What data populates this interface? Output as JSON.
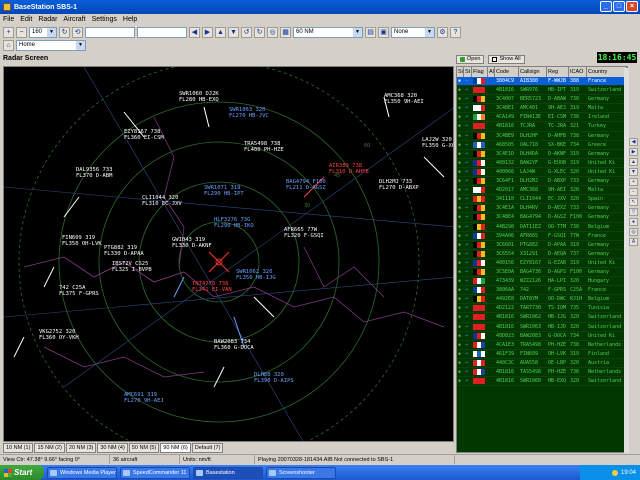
{
  "window": {
    "title": "BaseStation SBS-1"
  },
  "menu": [
    "File",
    "Edit",
    "Radar",
    "Aircraft",
    "Settings",
    "Help"
  ],
  "toolbar": {
    "zoom_value": "160",
    "range_value": "60 NM",
    "filter_value": "None"
  },
  "toolbar2": {
    "location_value": "Home"
  },
  "clock": "18:16:45",
  "radar": {
    "title": "Radar Screen",
    "aircraft": [
      {
        "label": "SWR1060 DJ2K\nFL280 HB-EXQ",
        "color": "white"
      },
      {
        "label": "SWR1063 320\nFL270 HB-JVC",
        "color": "blue"
      },
      {
        "label": "AMC368 320\nFL350 9H-AEI",
        "color": "white"
      },
      {
        "label": "EZY8167 738\nFL360 EI-CSM",
        "color": "white"
      },
      {
        "label": "LAJ2W 320\nFL350 G-XC",
        "color": "white"
      },
      {
        "label": "TRA5498 738\nFL400 PH-HZE",
        "color": "white"
      },
      {
        "label": "SWR1071 319\nFL290 HB-IPT",
        "color": "blue"
      },
      {
        "label": "AIR389 738\nFL310 D-AHFB",
        "color": "red"
      },
      {
        "label": "DLH2MJ 733\nFL270 D-ABXP",
        "color": "white"
      },
      {
        "label": "DAL9356 733\nFL370 D-ABM",
        "color": "white"
      },
      {
        "label": "BAG4794 F100\nFL211 D-AGSZ",
        "color": "blue"
      },
      {
        "label": "HLF3276 73G\nFL290 HB-IKO",
        "color": "blue"
      },
      {
        "label": "CLI1044 320\nFL310 EC-JXV",
        "color": "white"
      },
      {
        "label": "FIN609 319\nFL350 OH-LVK",
        "color": "white"
      },
      {
        "label": "PTG882 319\nFL330 D-APAA",
        "color": "white"
      },
      {
        "label": "GWI043 319\nFL330 D-AKNF",
        "color": "white"
      },
      {
        "label": "AFR665 77W\nFL320 F-GSQI",
        "color": "white"
      },
      {
        "label": "IBS72V CS25\nFL325 I-BVPB",
        "color": "white"
      },
      {
        "label": "742 C25A\nFL375 F-GPRS",
        "color": "white"
      },
      {
        "label": "VKG2752 320\nFL360 OY-VKH",
        "color": "white"
      },
      {
        "label": "TNT4778 738\nFL341 EI-VAN",
        "color": "red"
      },
      {
        "label": "SWR1062 320\nFL350 HB-IJG",
        "color": "blue"
      },
      {
        "label": "BAW2083 734\nFL360 G-DOCA",
        "color": "white"
      },
      {
        "label": "AMC691 319\nFL270 9H-AEJ",
        "color": "blue"
      },
      {
        "label": "DLH88 320\nFL390 D-AIPS",
        "color": "blue"
      }
    ]
  },
  "tabs": [
    "10 NM (1)",
    "15 NM (2)",
    "20 NM (3)",
    "30 NM (4)",
    "50 NM (5)",
    "90 NM (6)",
    "Default (7)"
  ],
  "status": {
    "view": "View Ctr: 47.38° 9.66° facing 0°",
    "count": "36 aircraft",
    "units": "Units: nm/ft",
    "playing": "Playing 20070328-181434.AIB Not connected to SBS-1"
  },
  "list": {
    "open_label": "Open",
    "show_all_label": "Show All",
    "columns": [
      "Si",
      "St",
      "Flag",
      "Alt",
      "Code",
      "Callsign",
      "Reg",
      "ICAO",
      "Country"
    ],
    "rows": [
      {
        "code": "3804C9",
        "callsign": "AIB380",
        "reg": "F-WWJB",
        "icao": "388",
        "country": "France",
        "flag": [
          "#0040a0",
          "#ffffff",
          "#e02020"
        ],
        "sel": true
      },
      {
        "code": "4B1816",
        "callsign": "SWR976",
        "reg": "HB-IPT",
        "icao": "319",
        "country": "Switzerland",
        "flag": [
          "#e02020",
          "#e02020",
          "#e02020"
        ]
      },
      {
        "code": "3C4007",
        "callsign": "BER5723",
        "reg": "D-ABAW",
        "icao": "738",
        "country": "Germany",
        "flag": [
          "#000000",
          "#e02020",
          "#f0c020"
        ]
      },
      {
        "code": "3C4BE1",
        "callsign": "AMC401",
        "reg": "9H-AEJ",
        "icao": "319",
        "country": "Malta",
        "flag": [
          "#ffffff",
          "#ffffff",
          "#e02020"
        ]
      },
      {
        "code": "4CA149",
        "callsign": "FIN413E",
        "reg": "EI-CSM",
        "icao": "738",
        "country": "Ireland",
        "flag": [
          "#20a040",
          "#ffffff",
          "#f08020"
        ]
      },
      {
        "code": "4B1816",
        "callsign": "TCJRA",
        "reg": "TC-JRA",
        "icao": "321",
        "country": "Turkey",
        "flag": [
          "#e02020",
          "#e02020",
          "#e02020"
        ]
      },
      {
        "code": "3C4BE9",
        "callsign": "DLH2HF",
        "reg": "D-AHFB",
        "icao": "738",
        "country": "Germany",
        "flag": [
          "#000000",
          "#e02020",
          "#f0c020"
        ]
      },
      {
        "code": "468505",
        "callsign": "OAL718",
        "reg": "SX-BKE",
        "icao": "734",
        "country": "Greece",
        "flag": [
          "#2060c0",
          "#ffffff",
          "#2060c0"
        ]
      },
      {
        "code": "3C4E1D",
        "callsign": "DLH4DA",
        "reg": "D-AKNF",
        "icao": "319",
        "country": "Germany",
        "flag": [
          "#000000",
          "#e02020",
          "#f0c020"
        ]
      },
      {
        "code": "400132",
        "callsign": "BAW2YF",
        "reg": "G-EUOB",
        "icao": "319",
        "country": "United Ki",
        "flag": [
          "#1030a0",
          "#e02020",
          "#ffffff"
        ]
      },
      {
        "code": "400066",
        "callsign": "LAJ4W",
        "reg": "G-XLEC",
        "icao": "320",
        "country": "United Ki",
        "flag": [
          "#1030a0",
          "#e02020",
          "#ffffff"
        ]
      },
      {
        "code": "3C64F1",
        "callsign": "DLH2MJ",
        "reg": "D-ABXP",
        "icao": "733",
        "country": "Germany",
        "flag": [
          "#000000",
          "#e02020",
          "#f0c020"
        ]
      },
      {
        "code": "4D2017",
        "callsign": "AMC368",
        "reg": "9H-AEI",
        "icao": "320",
        "country": "Malta",
        "flag": [
          "#ffffff",
          "#ffffff",
          "#e02020"
        ]
      },
      {
        "code": "341110",
        "callsign": "CLI1044",
        "reg": "EC-JXV",
        "icao": "320",
        "country": "Spain",
        "flag": [
          "#e02020",
          "#f0c020",
          "#e02020"
        ]
      },
      {
        "code": "3C4E1A",
        "callsign": "DLH4RV",
        "reg": "D-AEXZ",
        "icao": "733",
        "country": "Germany",
        "flag": [
          "#000000",
          "#e02020",
          "#f0c020"
        ]
      },
      {
        "code": "3C4BE4",
        "callsign": "BAG4794",
        "reg": "D-AGSZ",
        "icao": "F100",
        "country": "Germany",
        "flag": [
          "#000000",
          "#e02020",
          "#f0c020"
        ]
      },
      {
        "code": "44B298",
        "callsign": "DAT11EZ",
        "reg": "OO-TTM",
        "icao": "738",
        "country": "Belgium",
        "flag": [
          "#000000",
          "#f0c020",
          "#e02020"
        ]
      },
      {
        "code": "394A06",
        "callsign": "AFR665",
        "reg": "F-GSQI",
        "icao": "77W",
        "country": "France",
        "flag": [
          "#0040a0",
          "#ffffff",
          "#e02020"
        ]
      },
      {
        "code": "3C6601",
        "callsign": "PTG882",
        "reg": "D-APAA",
        "icao": "319",
        "country": "Germany",
        "flag": [
          "#000000",
          "#e02020",
          "#f0c020"
        ]
      },
      {
        "code": "3C6554",
        "callsign": "X31291",
        "reg": "D-AEQA",
        "icao": "737",
        "country": "Germany",
        "flag": [
          "#000000",
          "#e02020",
          "#f0c020"
        ]
      },
      {
        "code": "400156",
        "callsign": "EZY8167",
        "reg": "G-EZAB",
        "icao": "319",
        "country": "United Ki",
        "flag": [
          "#1030a0",
          "#e02020",
          "#ffffff"
        ]
      },
      {
        "code": "3C5E0A",
        "callsign": "BAG4736",
        "reg": "D-AGPS",
        "icao": "F100",
        "country": "Germany",
        "flag": [
          "#000000",
          "#e02020",
          "#f0c020"
        ]
      },
      {
        "code": "473439",
        "callsign": "WZZ2126",
        "reg": "HA-LPI",
        "icao": "320",
        "country": "Hungary",
        "flag": [
          "#e02020",
          "#ffffff",
          "#20a040"
        ]
      },
      {
        "code": "3806AA",
        "callsign": "742",
        "reg": "F-GPRS",
        "icao": "C25A",
        "country": "France",
        "flag": [
          "#0040a0",
          "#ffffff",
          "#e02020"
        ]
      },
      {
        "code": "4492E8",
        "callsign": "DAT8YM",
        "reg": "OO-DWC",
        "icao": "RJ1H",
        "country": "Belgium",
        "flag": [
          "#000000",
          "#f0c020",
          "#e02020"
        ]
      },
      {
        "code": "4D2122",
        "callsign": "TAR7730",
        "reg": "TS-IOM",
        "icao": "735",
        "country": "Tunisia",
        "flag": [
          "#e02020",
          "#e02020",
          "#e02020"
        ]
      },
      {
        "code": "4B1816",
        "callsign": "SWR1062",
        "reg": "HB-IJG",
        "icao": "320",
        "country": "Switzerland",
        "flag": [
          "#e02020",
          "#e02020",
          "#e02020"
        ]
      },
      {
        "code": "4B1816",
        "callsign": "SWR1063",
        "reg": "HB-IJD",
        "icao": "320",
        "country": "Switzerland",
        "flag": [
          "#e02020",
          "#e02020",
          "#e02020"
        ]
      },
      {
        "code": "40D023",
        "callsign": "BAW2083",
        "reg": "G-DOCA",
        "icao": "734",
        "country": "United Ki",
        "flag": [
          "#1030a0",
          "#e02020",
          "#ffffff"
        ]
      },
      {
        "code": "4CA1E3",
        "callsign": "TRA5498",
        "reg": "PH-HZE",
        "icao": "738",
        "country": "Netherlands",
        "flag": [
          "#e02020",
          "#ffffff",
          "#2040a0"
        ]
      },
      {
        "code": "461F39",
        "callsign": "FIN609",
        "reg": "OH-LVK",
        "icao": "319",
        "country": "Finland",
        "flag": [
          "#ffffff",
          "#2060c0",
          "#ffffff"
        ]
      },
      {
        "code": "440C3C",
        "callsign": "AUA558",
        "reg": "OE-LBP",
        "icao": "320",
        "country": "Austria",
        "flag": [
          "#e02020",
          "#ffffff",
          "#e02020"
        ]
      },
      {
        "code": "4B1816",
        "callsign": "TAS5498",
        "reg": "PH-HZE",
        "icao": "738",
        "country": "Netherlands",
        "flag": [
          "#e02020",
          "#ffffff",
          "#2040a0"
        ]
      },
      {
        "code": "4B1816",
        "callsign": "SWR1060",
        "reg": "HB-EXQ",
        "icao": "320",
        "country": "Switzerland",
        "flag": [
          "#e02020",
          "#e02020",
          "#e02020"
        ]
      }
    ]
  },
  "taskbar": {
    "start_label": "Start",
    "tasks": [
      "Windows Media Player",
      "SpeedCommander 11",
      "Basestation",
      "Screenshooter"
    ],
    "active_task": 2,
    "time": "19:04"
  }
}
